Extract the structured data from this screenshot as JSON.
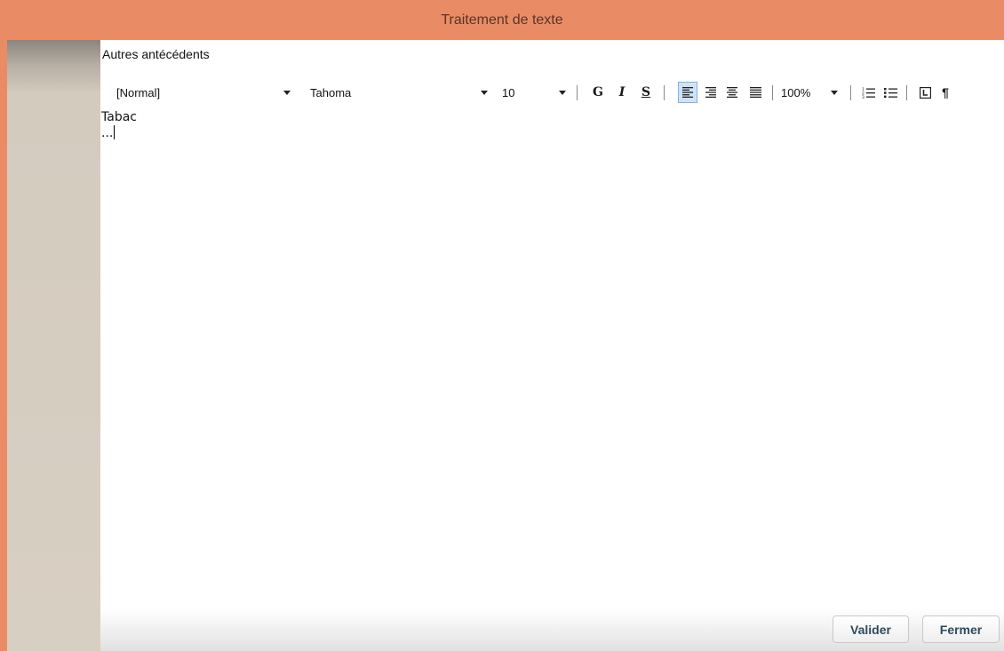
{
  "window": {
    "title": "Traitement de texte"
  },
  "section": {
    "title": "Autres antécédents"
  },
  "toolbar": {
    "style_value": "[Normal]",
    "font_value": "Tahoma",
    "size_value": "10",
    "bold_label": "G",
    "italic_label": "I",
    "underline_label": "S",
    "zoom_value": "100%",
    "paragraph_label": "¶"
  },
  "editor": {
    "lines": [
      "Tabac",
      "..."
    ]
  },
  "footer": {
    "validate_label": "Valider",
    "close_label": "Fermer"
  },
  "colors": {
    "title_bar": "#e98c66",
    "sidebar": "#d8cfc3",
    "active_button": "#cfe3f7"
  },
  "icons": {
    "align_left": "align-left-icon",
    "align_right": "align-right-icon",
    "align_center": "align-center-icon",
    "align_justify": "align-justify-icon",
    "numbered_list": "numbered-list-icon",
    "bulleted_list": "bulleted-list-icon",
    "tab_stop": "tab-stop-icon"
  }
}
